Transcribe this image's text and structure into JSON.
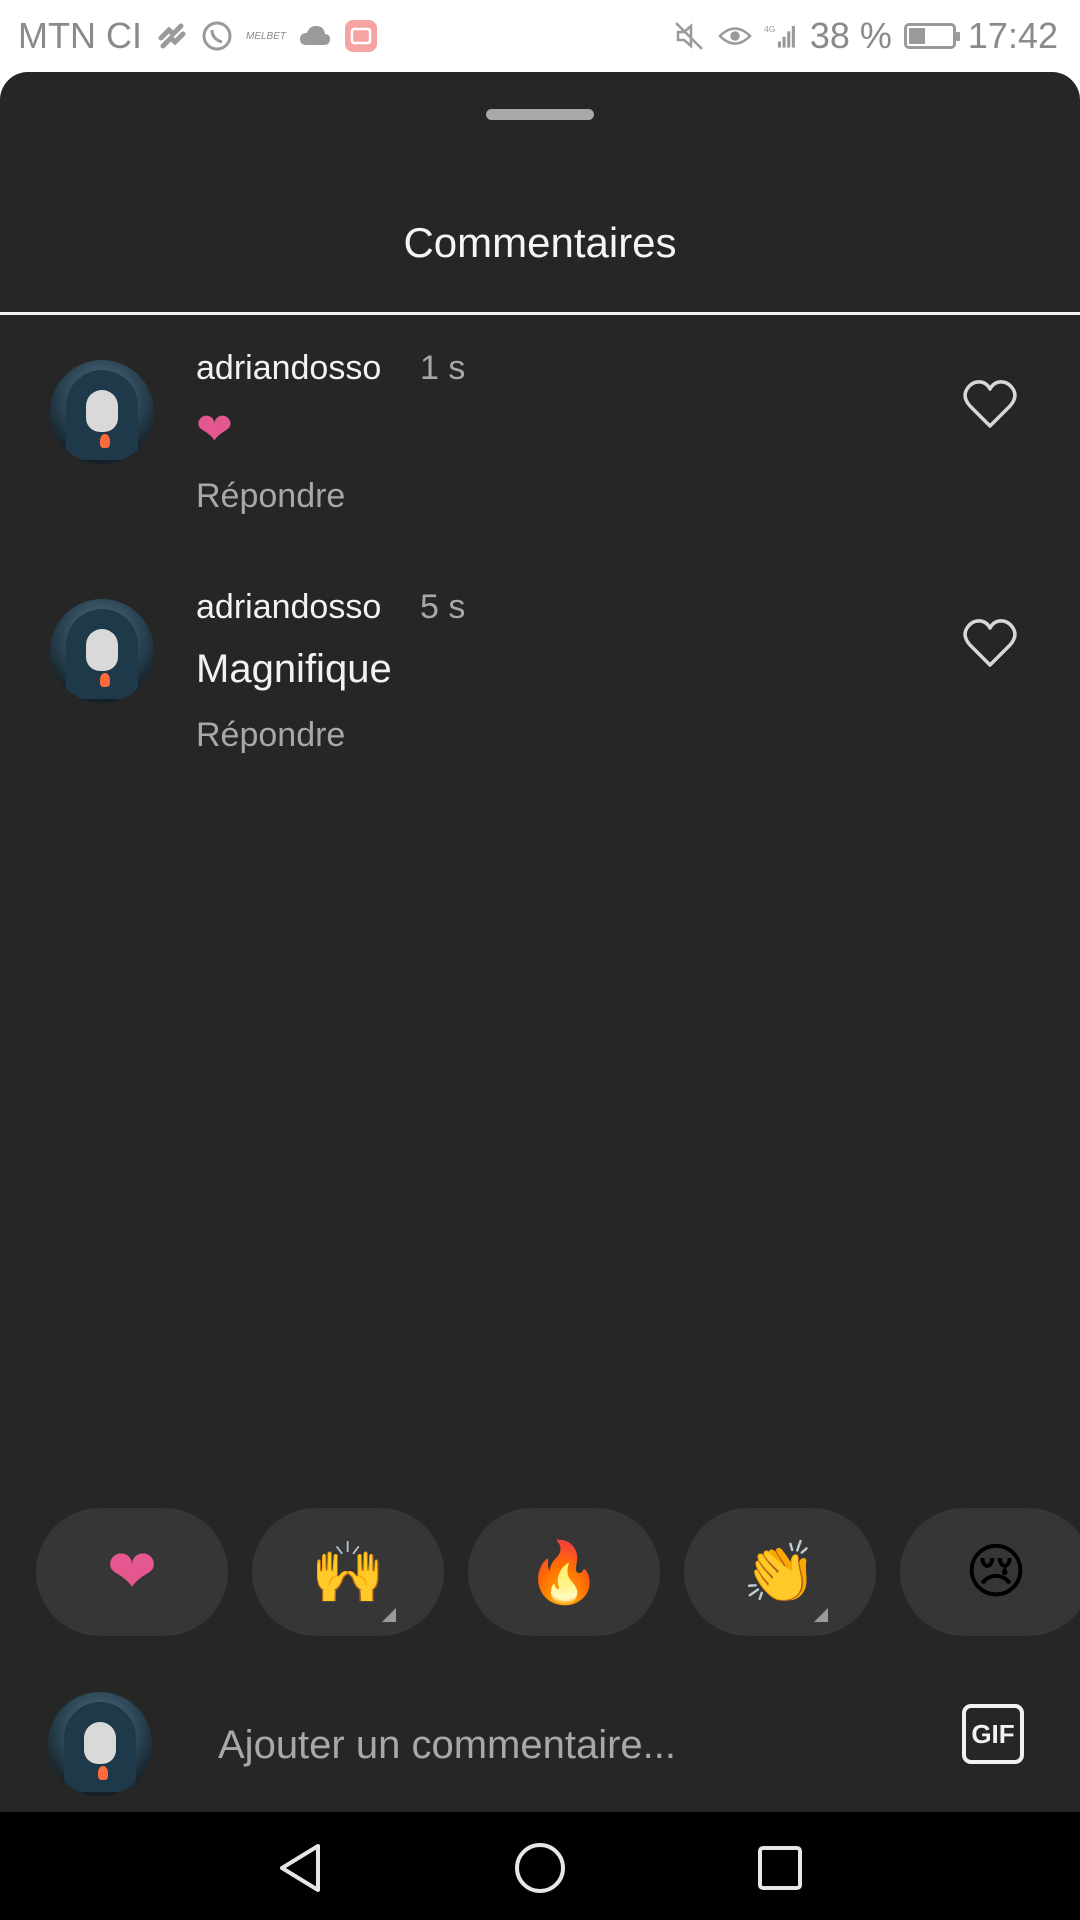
{
  "status_bar": {
    "carrier": "MTN CI",
    "mini_app_label": "MELBET",
    "network_type": "4G",
    "battery_percent": "38 %",
    "battery_level": 0.38,
    "time": "17:42",
    "icons": [
      "verified-badge-icon",
      "whatsapp-icon",
      "cloud-icon",
      "gallery-app-icon",
      "mute-icon",
      "eye-icon",
      "signal-icon",
      "battery-icon"
    ]
  },
  "sheet": {
    "title": "Commentaires"
  },
  "comments": [
    {
      "username": "adriandosso",
      "time": "1 s",
      "text": "❤",
      "reply_label": "Répondre",
      "like_icon": "heart-outline-icon"
    },
    {
      "username": "adriandosso",
      "time": "5 s",
      "text": "Magnifique",
      "reply_label": "Répondre",
      "like_icon": "heart-outline-icon"
    }
  ],
  "reactions": [
    {
      "emoji": "❤",
      "name": "heart",
      "has_variants": false
    },
    {
      "emoji": "🙌",
      "name": "raising-hands",
      "has_variants": true
    },
    {
      "emoji": "🔥",
      "name": "fire",
      "has_variants": false
    },
    {
      "emoji": "👏",
      "name": "clapping-hands",
      "has_variants": true
    },
    {
      "emoji": "😢",
      "name": "crying-face",
      "has_variants": false
    }
  ],
  "composer": {
    "placeholder": "Ajouter un commentaire...",
    "gif_label": "GIF"
  },
  "nav": {
    "icons": [
      "back-icon",
      "home-icon",
      "recents-icon"
    ]
  },
  "colors": {
    "sheet_bg": "#262626",
    "pill_bg": "#363636",
    "heart_pink": "#e5588f",
    "muted_text": "#a8a8a8"
  }
}
